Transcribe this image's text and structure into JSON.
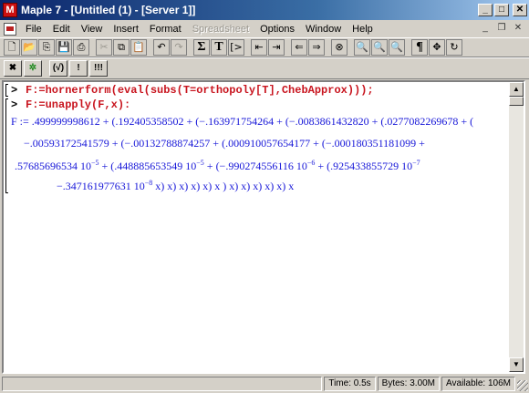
{
  "window": {
    "title": "Maple 7 - [Untitled (1) - [Server 1]]",
    "app_icon_glyph": "M",
    "min_glyph": "_",
    "max_glyph": "□",
    "close_glyph": "✕"
  },
  "menu": {
    "items": [
      "File",
      "Edit",
      "View",
      "Insert",
      "Format",
      "Spreadsheet",
      "Options",
      "Window",
      "Help"
    ],
    "disabled": [
      "Spreadsheet"
    ],
    "mdi_min": "_",
    "mdi_restore": "❐",
    "mdi_close": "✕"
  },
  "toolbar1": {
    "buttons": [
      {
        "icon": "new-icon",
        "glyph": "🗋"
      },
      {
        "icon": "open-icon",
        "glyph": "📂"
      },
      {
        "icon": "open-url-icon",
        "glyph": "⎘"
      },
      {
        "icon": "save-icon",
        "glyph": "💾"
      },
      {
        "icon": "print-icon",
        "glyph": "⎙"
      },
      {
        "icon": "cut-icon",
        "glyph": "✂"
      },
      {
        "icon": "copy-icon",
        "glyph": "⧉"
      },
      {
        "icon": "paste-icon",
        "glyph": "📋"
      },
      {
        "icon": "undo-icon",
        "glyph": "↶"
      },
      {
        "icon": "redo-icon",
        "glyph": "↷"
      },
      {
        "icon": "math-input-icon",
        "glyph": "Σ"
      },
      {
        "icon": "text-input-icon",
        "glyph": "T"
      },
      {
        "icon": "insert-prompt-icon",
        "glyph": "[>"
      },
      {
        "icon": "indent-icon",
        "glyph": "⇤"
      },
      {
        "icon": "outdent-icon",
        "glyph": "⇥"
      },
      {
        "icon": "back-icon",
        "glyph": "⇐"
      },
      {
        "icon": "forward-icon",
        "glyph": "⇒"
      },
      {
        "icon": "stop-icon",
        "glyph": "⊗"
      },
      {
        "icon": "zoom-100-icon",
        "glyph": "🔍"
      },
      {
        "icon": "zoom-150-icon",
        "glyph": "🔍"
      },
      {
        "icon": "zoom-200-icon",
        "glyph": "🔍"
      },
      {
        "icon": "paragraph-icon",
        "glyph": "¶"
      },
      {
        "icon": "expand-icon",
        "glyph": "✥"
      },
      {
        "icon": "restart-icon",
        "glyph": "↻"
      }
    ]
  },
  "toolbar2": {
    "buttons": [
      {
        "icon": "interrupt-icon",
        "glyph": "✖"
      },
      {
        "icon": "debug-icon",
        "glyph": "✲"
      },
      {
        "icon": "execute-selection-icon",
        "glyph": "(√)"
      },
      {
        "icon": "execute-icon",
        "glyph": "!"
      },
      {
        "icon": "execute-all-icon",
        "glyph": "!!!"
      }
    ]
  },
  "worksheet": {
    "prompt": ">",
    "commands": [
      "F:=hornerform(eval(subs(T=orthopoly[T],ChebApprox)));",
      "F:=unapply(F,x):"
    ],
    "output": {
      "line1": "F := .499999998612 + (.192405358502 + (−.163971754264 + (−.0083861432820 + (.0277082269678 + (",
      "line2": "−.00593172541579 + (−.00132788874257 + (.000910057654177 + (−.000180351181099 +",
      "line3_a": ".57685696534 10",
      "line3_a_exp": "−5",
      "line3_b": " + (.448885653549 10",
      "line3_b_exp": "−5",
      "line3_c": " + (−.990274556116 10",
      "line3_c_exp": "−6",
      "line3_d": " + (.925433855729 10",
      "line3_d_exp": "−7",
      "line4_a": "−.347161977631 10",
      "line4_a_exp": "−8",
      "line4_b": " x) x) x) x) x) x  ) x) x) x) x) x) x"
    }
  },
  "status": {
    "time": "Time:  0.5s",
    "bytes": "Bytes: 3.00M",
    "available": "Available: 106M"
  }
}
